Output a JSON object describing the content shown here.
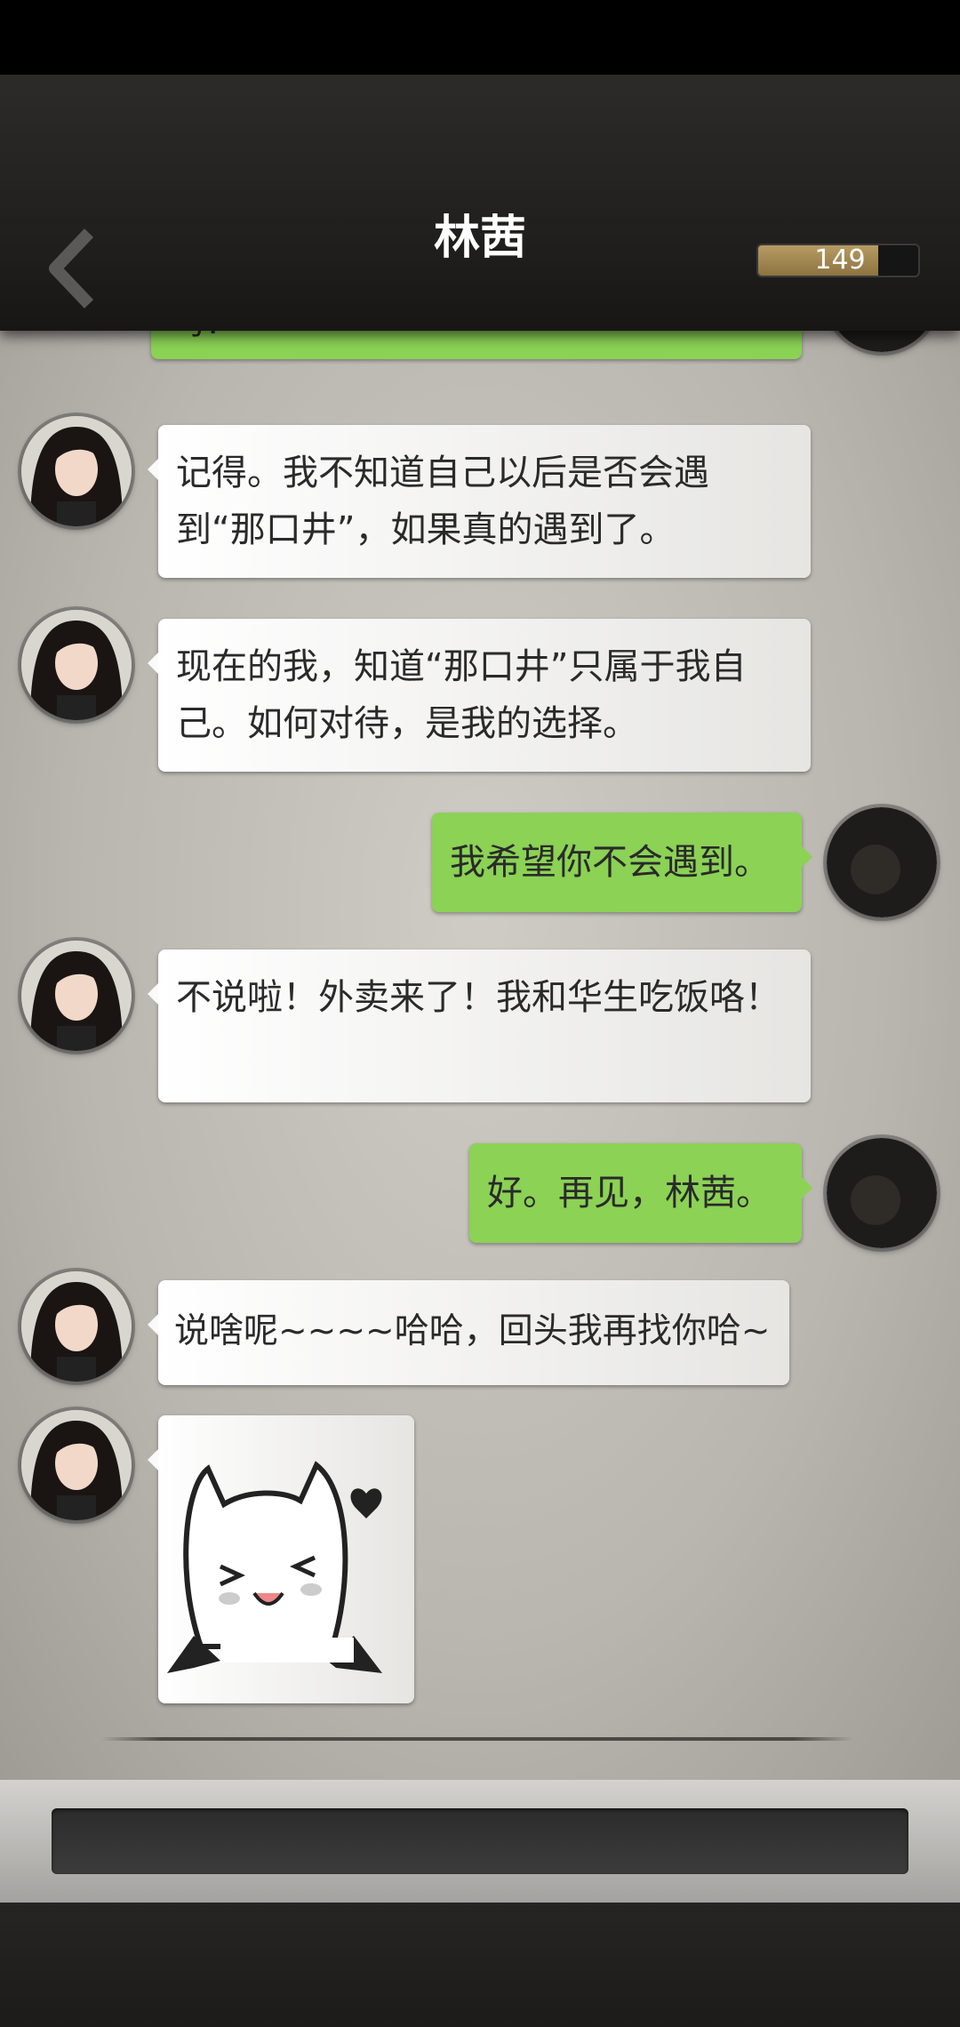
{
  "header": {
    "title": "林茜",
    "energy_value": "149",
    "energy_fill_fraction": 0.75
  },
  "messages": [
    {
      "side": "out",
      "text": "吗?"
    },
    {
      "side": "in",
      "text": "记得。我不知道自己以后是否会遇到“那口井”，如果真的遇到了。"
    },
    {
      "side": "in",
      "text": "现在的我，知道“那口井”只属于我自己。如何对待，是我的选择。"
    },
    {
      "side": "out",
      "text": "我希望你不会遇到。"
    },
    {
      "side": "in",
      "text": "不说啦！外卖来了！我和华生吃饭咯！"
    },
    {
      "side": "out",
      "text": "好。再见，林茜。"
    },
    {
      "side": "in",
      "text": "说啥呢~~~~哈哈，回头我再找你哈~"
    },
    {
      "side": "in",
      "type": "sticker",
      "sticker": "vampire-cat-sticker"
    }
  ],
  "colors": {
    "outgoing_bubble": "#8bd255",
    "incoming_bubble": "#f2f1ee",
    "header_bg": "#242321"
  },
  "icons": {
    "back": "chevron-left-icon"
  }
}
